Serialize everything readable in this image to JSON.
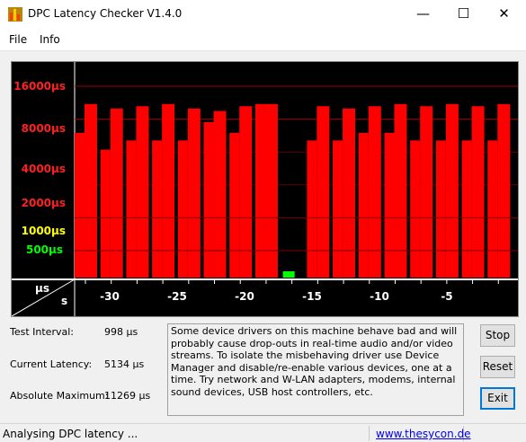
{
  "window": {
    "title": "DPC Latency Checker V1.4.0",
    "minimize_glyph": "—",
    "maximize_glyph": "☐",
    "close_glyph": "✕"
  },
  "menu": {
    "items": [
      "File",
      "Info"
    ]
  },
  "colors": {
    "bar": "#ff0000",
    "good_bar": "#00ff00",
    "yellow_label": "#ffff00",
    "green_label": "#00ff00",
    "red_label": "#ff0000",
    "gridline": "#a00000"
  },
  "chart_data": {
    "type": "bar",
    "y_unit": "µs",
    "x_unit": "s",
    "y_tick_labels": [
      {
        "text": "16000µs",
        "color": "red"
      },
      {
        "text": "8000µs",
        "color": "red"
      },
      {
        "text": "4000µs",
        "color": "red"
      },
      {
        "text": "2000µs",
        "color": "red"
      },
      {
        "text": "1000µs",
        "color": "yellow"
      },
      {
        "text": "500µs",
        "color": "green"
      }
    ],
    "x_tick_labels": [
      "-30",
      "-25",
      "-20",
      "-15",
      "-10",
      "-5"
    ],
    "x_range": [
      -34,
      0
    ],
    "bars": [
      {
        "x": -34,
        "primary": 6000,
        "secondary": 11000
      },
      {
        "x": -32,
        "primary": 4200,
        "secondary": 10000
      },
      {
        "x": -30,
        "primary": 5100,
        "secondary": 10500
      },
      {
        "x": -28,
        "primary": 5100,
        "secondary": 11000
      },
      {
        "x": -26,
        "primary": 5100,
        "secondary": 10000
      },
      {
        "x": -24,
        "primary": 7500,
        "secondary": 9500
      },
      {
        "x": -22,
        "primary": 6000,
        "secondary": 10500
      },
      {
        "x": -20,
        "primary": 11000,
        "secondary": 11000
      },
      {
        "x": -18,
        "primary": 200,
        "secondary": 0,
        "good": true
      },
      {
        "x": -16,
        "primary": 5100,
        "secondary": 10500
      },
      {
        "x": -14,
        "primary": 5100,
        "secondary": 10000
      },
      {
        "x": -12,
        "primary": 6000,
        "secondary": 10500
      },
      {
        "x": -10,
        "primary": 6000,
        "secondary": 11000
      },
      {
        "x": -8,
        "primary": 5100,
        "secondary": 10500
      },
      {
        "x": -6,
        "primary": 5100,
        "secondary": 11000
      },
      {
        "x": -4,
        "primary": 5100,
        "secondary": 10500
      },
      {
        "x": -2,
        "primary": 5100,
        "secondary": 11000
      }
    ]
  },
  "axis_corner": {
    "y_unit": "µs",
    "x_unit": "s"
  },
  "stats": {
    "test_interval_label": "Test Interval:",
    "test_interval_value": "998 µs",
    "current_latency_label": "Current Latency:",
    "current_latency_value": "5134 µs",
    "absolute_maximum_label": "Absolute Maximum:",
    "absolute_maximum_value": "11269 µs"
  },
  "message": "Some device drivers on this machine behave bad and will probably cause drop-outs in real-time audio and/or video streams. To isolate the misbehaving driver use Device Manager and disable/re-enable various devices, one at a time. Try network and W-LAN adapters, modems, internal sound devices, USB host controllers, etc.",
  "buttons": {
    "stop": "Stop",
    "reset": "Reset",
    "exit": "Exit"
  },
  "status": {
    "text": "Analysing DPC latency ...",
    "link": "www.thesycon.de"
  }
}
